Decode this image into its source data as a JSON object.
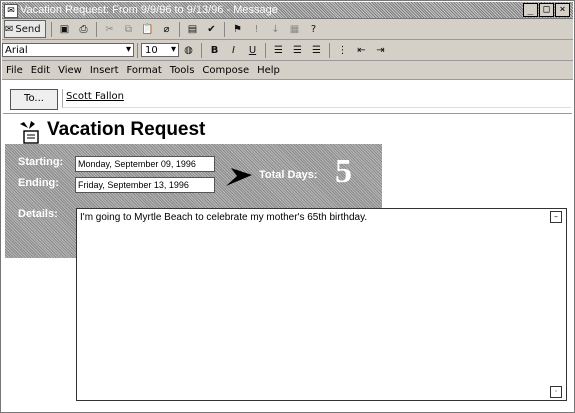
{
  "window": {
    "title": "Vacation Request: From 9/9/96 to 9/13/96 - Message",
    "controls": [
      "_",
      "□",
      "×"
    ]
  },
  "toolbar1": {
    "send_label": "Send",
    "buttons": [
      "save-icon",
      "print-icon",
      "cut-icon",
      "copy-icon",
      "paste-icon",
      "attach-icon",
      "address-book-icon",
      "check-names-icon",
      "flag-icon",
      "importance-high-icon",
      "importance-low-icon",
      "properties-icon",
      "help-icon"
    ]
  },
  "format_toolbar": {
    "font": "Arial",
    "size": "10",
    "buttons": [
      "color-icon",
      "bold-icon",
      "italic-icon",
      "underline-icon",
      "align-left-icon",
      "center-icon",
      "align-right-icon",
      "bullets-icon",
      "decrease-indent-icon",
      "increase-indent-icon"
    ]
  },
  "menubar": {
    "items": [
      "File",
      "Edit",
      "View",
      "Insert",
      "Format",
      "Tools",
      "Compose",
      "Help"
    ]
  },
  "to": {
    "button_label": "To...",
    "value": "Scott Fallon"
  },
  "form": {
    "title": "Vacation Request",
    "starting_label": "Starting:",
    "starting_value": "Monday, September 09, 1996",
    "ending_label": "Ending:",
    "ending_value": "Friday, September 13, 1996",
    "total_label": "Total Days:",
    "total_value": "5",
    "details_label": "Details:",
    "details_value": "I'm going to Myrtle Beach to celebrate my mother's 65th birthday."
  }
}
